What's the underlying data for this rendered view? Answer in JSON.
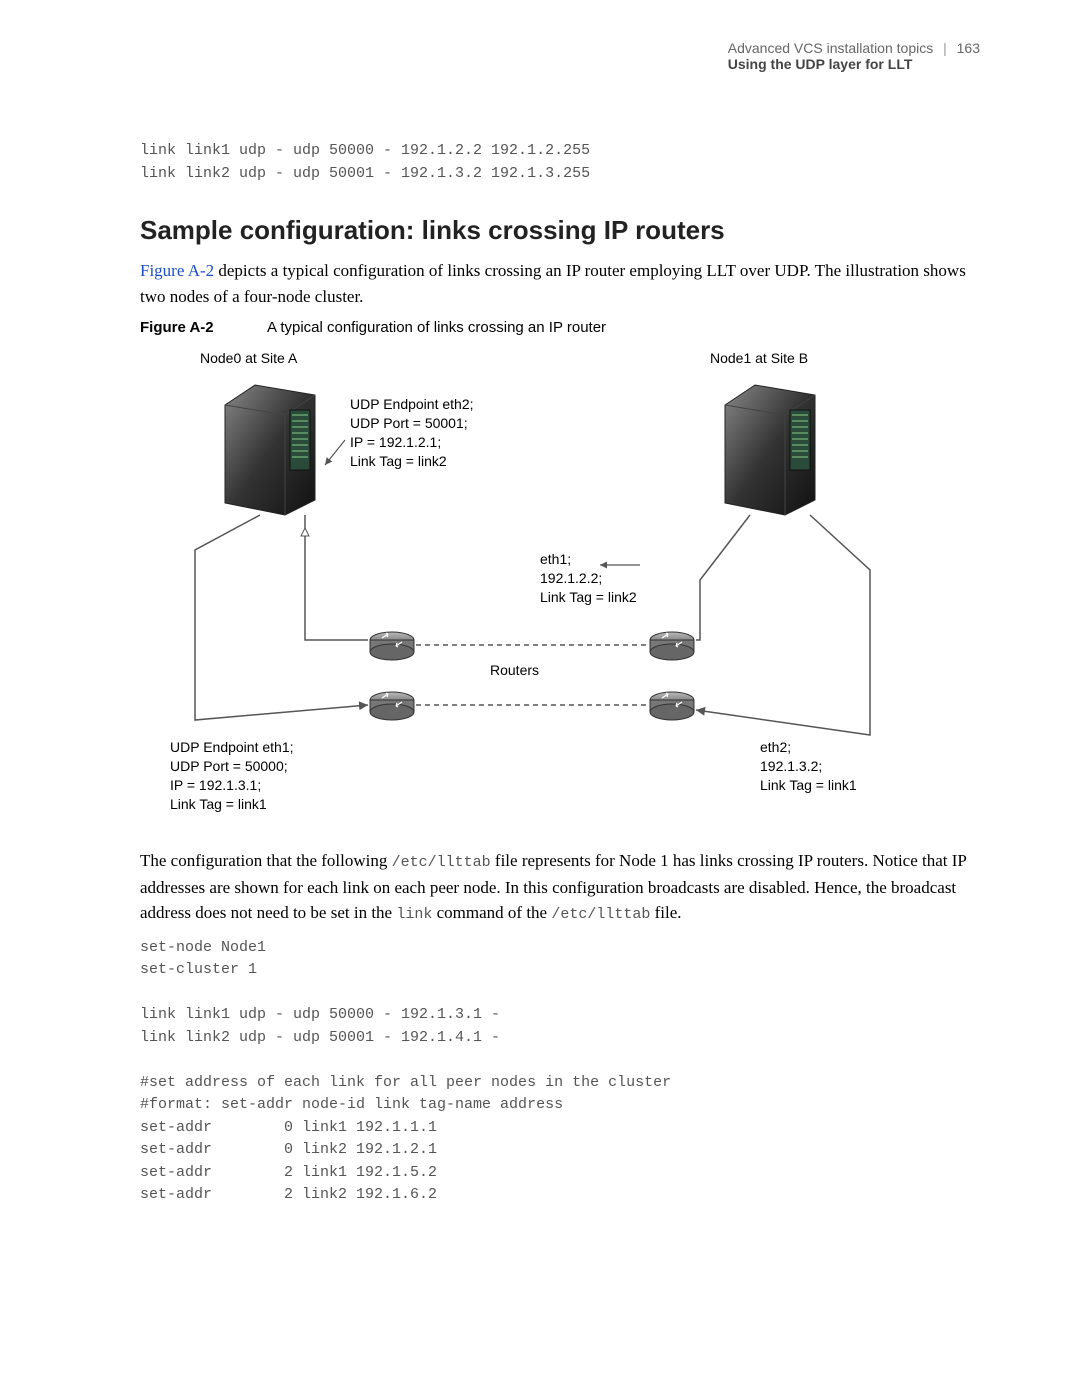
{
  "header": {
    "chapter": "Advanced VCS installation topics",
    "page_number": "163",
    "section": "Using the UDP layer for LLT"
  },
  "top_code": "link link1 udp - udp 50000 - 192.1.2.2 192.1.2.255\nlink link2 udp - udp 50001 - 192.1.3.2 192.1.3.255",
  "heading": "Sample configuration: links crossing IP routers",
  "intro_para": {
    "link_text": "Figure A-2",
    "rest": " depicts a typical configuration of links crossing an IP router employing LLT over UDP. The illustration shows two nodes of a four-node cluster."
  },
  "figure": {
    "label": "Figure A-2",
    "caption": "A typical configuration of links crossing an IP router",
    "node0_label": "Node0 at Site A",
    "node1_label": "Node1 at Site B",
    "endpoint_eth2": {
      "l1": "UDP Endpoint eth2;",
      "l2": "UDP Port = 50001;",
      "l3": "IP = 192.1.2.1;",
      "l4": "Link Tag = link2"
    },
    "eth1_box": {
      "l1": "eth1;",
      "l2": "192.1.2.2;",
      "l3": "Link Tag = link2"
    },
    "endpoint_eth1": {
      "l1": "UDP Endpoint eth1;",
      "l2": "UDP Port = 50000;",
      "l3": "IP = 192.1.3.1;",
      "l4": "Link Tag = link1"
    },
    "eth2_box": {
      "l1": "eth2;",
      "l2": "192.1.3.2;",
      "l3": "Link Tag = link1"
    },
    "routers_label": "Routers"
  },
  "config_para": {
    "p1": "The configuration that the following ",
    "c1": "/etc/llttab",
    "p2": " file represents for Node 1 has links crossing IP routers. Notice that IP addresses are shown for each link on each peer node. In this configuration broadcasts are disabled. Hence, the broadcast address does not need to be set in the ",
    "c2": "link",
    "p3": " command of the ",
    "c3": "/etc/llttab",
    "p4": " file."
  },
  "bottom_code": "set-node Node1\nset-cluster 1\n\nlink link1 udp - udp 50000 - 192.1.3.1 -\nlink link2 udp - udp 50001 - 192.1.4.1 -\n\n#set address of each link for all peer nodes in the cluster\n#format: set-addr node-id link tag-name address\nset-addr        0 link1 192.1.1.1\nset-addr        0 link2 192.1.2.1\nset-addr        2 link1 192.1.5.2\nset-addr        2 link2 192.1.6.2"
}
